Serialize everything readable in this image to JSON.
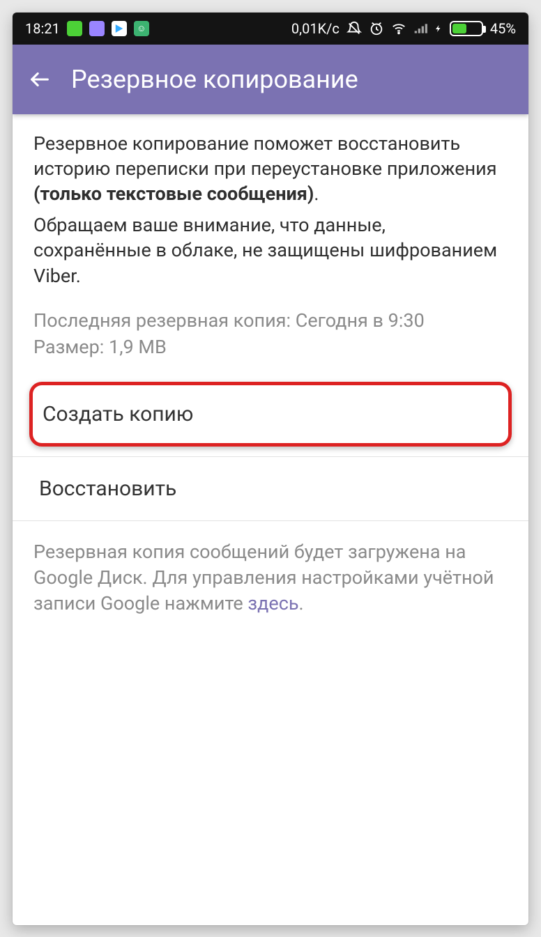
{
  "statusbar": {
    "time": "18:21",
    "net_rate": "0,01K/c",
    "battery_pct": "45%",
    "battery_fill_pct": 45
  },
  "appbar": {
    "title": "Резервное копирование"
  },
  "description": {
    "part1": "Резервное копирование поможет восстановить историю переписки при переустановке приложения ",
    "bold": "(только текстовые сообщения)",
    "period": ".",
    "part2": "Обращаем ваше внимание, что данные, сохранённые в облаке, не защищены шифрованием Viber."
  },
  "last_backup": {
    "label": "Последняя резервная копия:",
    "value": "Сегодня в 9:30"
  },
  "size": {
    "label": "Размер:",
    "value": "1,9 MB"
  },
  "actions": {
    "create": "Создать копию",
    "restore": "Восстановить"
  },
  "footer": {
    "text": "Резервная копия сообщений будет загружена на Google Диск. Для управления настройками учётной записи Google нажмите ",
    "link": "здесь",
    "suffix": "."
  }
}
